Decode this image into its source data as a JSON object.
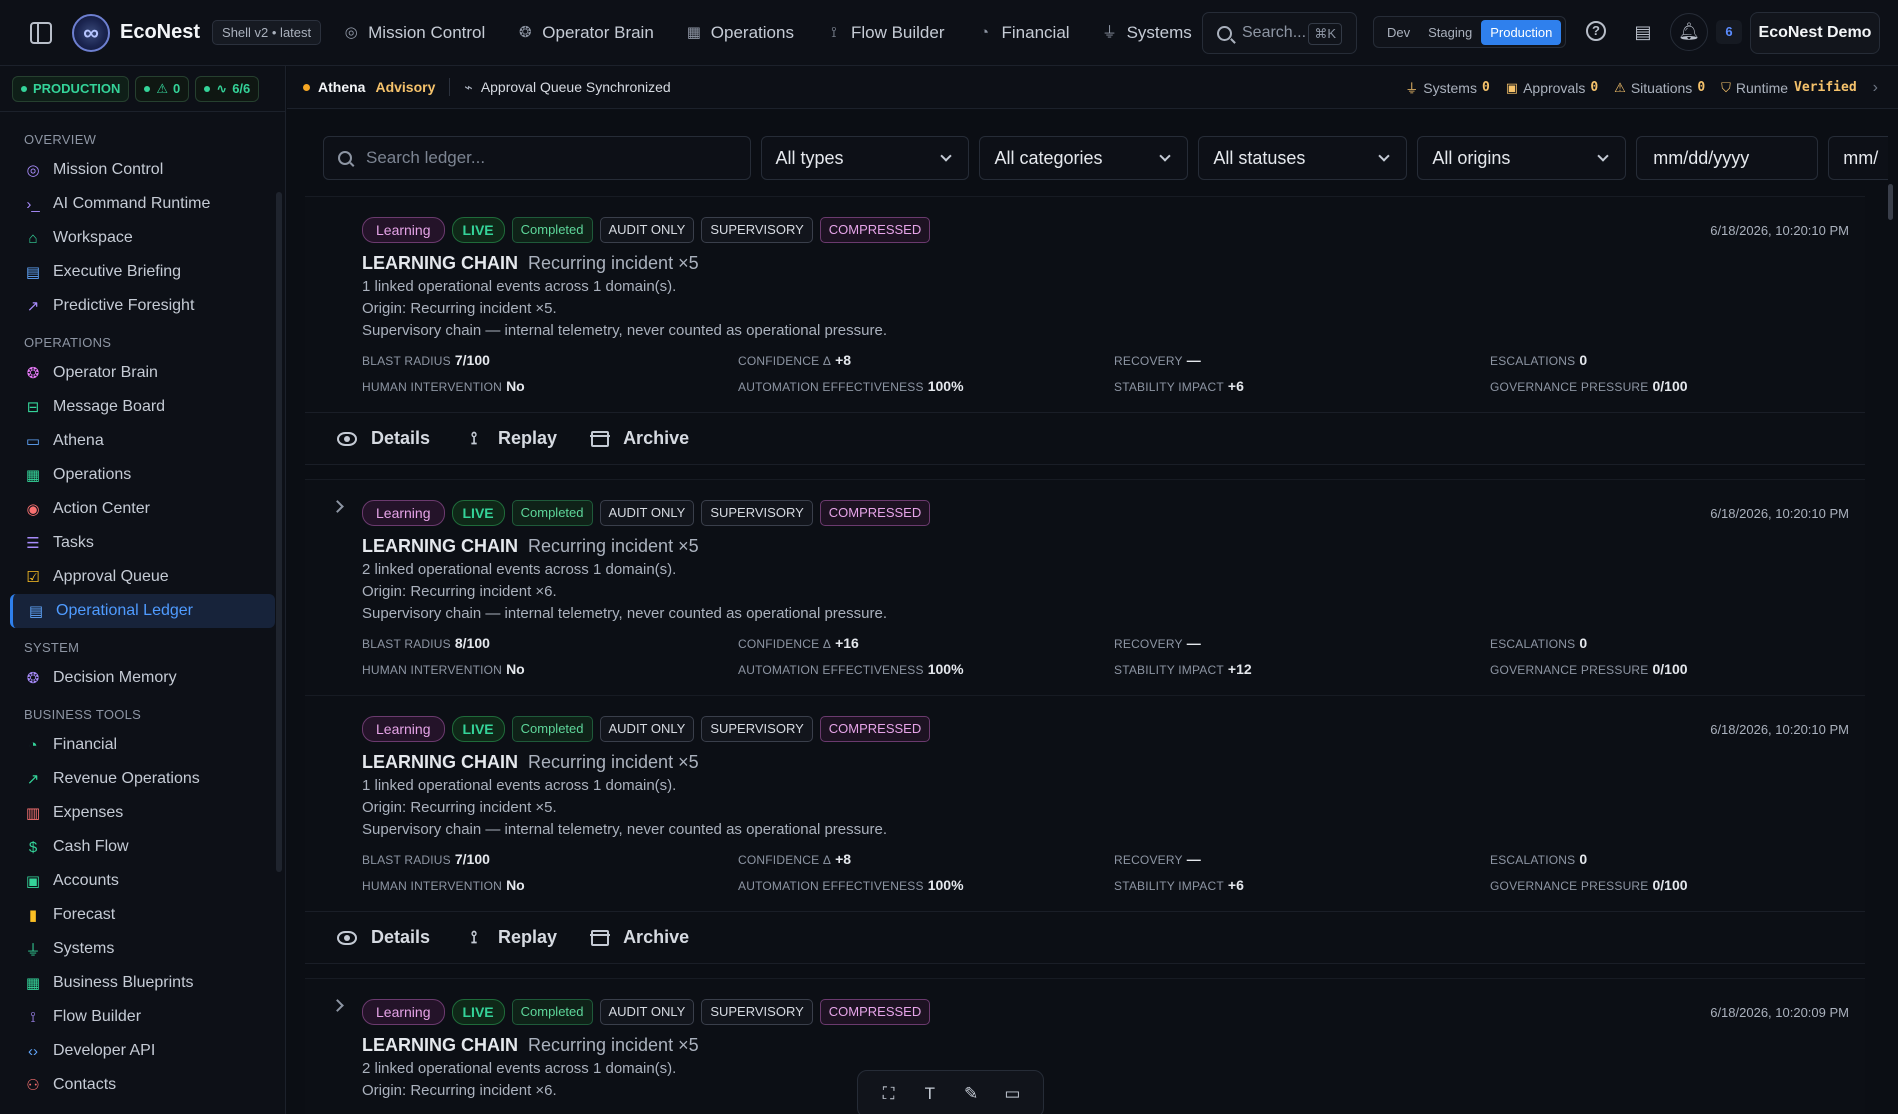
{
  "topbar": {
    "brand": "EcoNest",
    "shell_badge": "Shell v2 • latest",
    "nav": [
      {
        "label": "Mission Control",
        "icon": "gauge-icon"
      },
      {
        "label": "Operator Brain",
        "icon": "brain-icon"
      },
      {
        "label": "Operations",
        "icon": "grid-icon"
      },
      {
        "label": "Flow Builder",
        "icon": "flow-icon"
      },
      {
        "label": "Financial",
        "icon": "speedometer-icon"
      },
      {
        "label": "Systems",
        "icon": "plug-icon"
      }
    ],
    "search_placeholder": "Search...",
    "search_shortcut": "⌘K",
    "environments": [
      "Dev",
      "Staging",
      "Production"
    ],
    "active_environment": "Production",
    "notification_count": "6",
    "account": "EcoNest Demo"
  },
  "sidebar": {
    "status": {
      "environment": "PRODUCTION",
      "alerts": "0",
      "health": "6/6"
    },
    "sections": [
      {
        "title": "OVERVIEW",
        "items": [
          {
            "label": "Mission Control",
            "icon": "gauge-icon",
            "color": "#a78bfa"
          },
          {
            "label": "AI Command Runtime",
            "icon": "terminal-icon",
            "color": "#a78bfa"
          },
          {
            "label": "Workspace",
            "icon": "home-icon",
            "color": "#34d399"
          },
          {
            "label": "Executive Briefing",
            "icon": "document-icon",
            "color": "#60a5fa"
          },
          {
            "label": "Predictive Foresight",
            "icon": "trend-up-icon",
            "color": "#a78bfa"
          }
        ]
      },
      {
        "title": "OPERATIONS",
        "items": [
          {
            "label": "Operator Brain",
            "icon": "brain-icon",
            "color": "#e879f9"
          },
          {
            "label": "Message Board",
            "icon": "inbox-icon",
            "color": "#34d399"
          },
          {
            "label": "Athena",
            "icon": "chat-icon",
            "color": "#60a5fa"
          },
          {
            "label": "Operations",
            "icon": "grid-icon",
            "color": "#34d399"
          },
          {
            "label": "Action Center",
            "icon": "target-icon",
            "color": "#f87171"
          },
          {
            "label": "Tasks",
            "icon": "list-check-icon",
            "color": "#a78bfa"
          },
          {
            "label": "Approval Queue",
            "icon": "check-square-icon",
            "color": "#fbbf24"
          },
          {
            "label": "Operational Ledger",
            "icon": "ledger-icon",
            "color": "#60a5fa",
            "active": true
          }
        ]
      },
      {
        "title": "SYSTEM",
        "items": [
          {
            "label": "Decision Memory",
            "icon": "brain-icon",
            "color": "#a78bfa"
          }
        ]
      },
      {
        "title": "BUSINESS TOOLS",
        "items": [
          {
            "label": "Financial",
            "icon": "speedometer-icon",
            "color": "#34d399"
          },
          {
            "label": "Revenue Operations",
            "icon": "trend-up-icon",
            "color": "#34d399"
          },
          {
            "label": "Expenses",
            "icon": "receipt-icon",
            "color": "#f87171"
          },
          {
            "label": "Cash Flow",
            "icon": "dollar-icon",
            "color": "#34d399"
          },
          {
            "label": "Accounts",
            "icon": "wallet-icon",
            "color": "#34d399"
          },
          {
            "label": "Forecast",
            "icon": "bar-chart-icon",
            "color": "#fbbf24"
          },
          {
            "label": "Systems",
            "icon": "plug-icon",
            "color": "#34d399"
          },
          {
            "label": "Business Blueprints",
            "icon": "grid-icon",
            "color": "#34d399"
          },
          {
            "label": "Flow Builder",
            "icon": "flow-icon",
            "color": "#a78bfa"
          },
          {
            "label": "Developer API",
            "icon": "code-icon",
            "color": "#60a5fa"
          },
          {
            "label": "Contacts",
            "icon": "users-icon",
            "color": "#f87171"
          }
        ]
      }
    ]
  },
  "context": {
    "agent": "Athena",
    "mode": "Advisory",
    "status": "Approval Queue Synchronized",
    "metrics": [
      {
        "label": "Systems",
        "value": "0"
      },
      {
        "label": "Approvals",
        "value": "0"
      },
      {
        "label": "Situations",
        "value": "0"
      },
      {
        "label": "Runtime",
        "value": "Verified"
      }
    ]
  },
  "filters": {
    "search_placeholder": "Search ledger...",
    "type": "All types",
    "category": "All categories",
    "status": "All statuses",
    "origin": "All origins",
    "date_from": "mm/dd/yyyy",
    "date_to": "mm/"
  },
  "entries": [
    {
      "tags": [
        "Learning",
        "LIVE",
        "Completed",
        "AUDIT ONLY",
        "SUPERVISORY",
        "COMPRESSED"
      ],
      "timestamp": "6/18/2026, 10:20:10 PM",
      "kind": "LEARNING CHAIN",
      "subtitle": "Recurring incident ×5",
      "lines": [
        "1 linked operational events across 1 domain(s).",
        "Origin: Recurring incident ×5.",
        "Supervisory chain — internal telemetry, never counted as operational pressure."
      ],
      "metrics": {
        "blast_radius": "7/100",
        "confidence_delta": "+8",
        "recovery": "—",
        "escalations": "0",
        "human_intervention": "No",
        "automation_effectiveness": "100%",
        "stability_impact": "+6",
        "governance_pressure": "0/100"
      },
      "expanded": true
    },
    {
      "tags": [
        "Learning",
        "LIVE",
        "Completed",
        "AUDIT ONLY",
        "SUPERVISORY",
        "COMPRESSED"
      ],
      "timestamp": "6/18/2026, 10:20:10 PM",
      "kind": "LEARNING CHAIN",
      "subtitle": "Recurring incident ×5",
      "lines": [
        "2 linked operational events across 1 domain(s).",
        "Origin: Recurring incident ×6.",
        "Supervisory chain — internal telemetry, never counted as operational pressure."
      ],
      "metrics": {
        "blast_radius": "8/100",
        "confidence_delta": "+16",
        "recovery": "—",
        "escalations": "0",
        "human_intervention": "No",
        "automation_effectiveness": "100%",
        "stability_impact": "+12",
        "governance_pressure": "0/100"
      },
      "expanded": false
    },
    {
      "tags": [
        "Learning",
        "LIVE",
        "Completed",
        "AUDIT ONLY",
        "SUPERVISORY",
        "COMPRESSED"
      ],
      "timestamp": "6/18/2026, 10:20:10 PM",
      "kind": "LEARNING CHAIN",
      "subtitle": "Recurring incident ×5",
      "lines": [
        "1 linked operational events across 1 domain(s).",
        "Origin: Recurring incident ×5.",
        "Supervisory chain — internal telemetry, never counted as operational pressure."
      ],
      "metrics": {
        "blast_radius": "7/100",
        "confidence_delta": "+8",
        "recovery": "—",
        "escalations": "0",
        "human_intervention": "No",
        "automation_effectiveness": "100%",
        "stability_impact": "+6",
        "governance_pressure": "0/100"
      },
      "expanded": true
    },
    {
      "tags": [
        "Learning",
        "LIVE",
        "Completed",
        "AUDIT ONLY",
        "SUPERVISORY",
        "COMPRESSED"
      ],
      "timestamp": "6/18/2026, 10:20:09 PM",
      "kind": "LEARNING CHAIN",
      "subtitle": "Recurring incident ×5",
      "lines": [
        "2 linked operational events across 1 domain(s).",
        "Origin: Recurring incident ×6."
      ],
      "metrics": null,
      "expanded": false
    }
  ],
  "metric_labels": {
    "blast_radius": "BLAST RADIUS",
    "confidence_delta": "CONFIDENCE Δ",
    "recovery": "RECOVERY",
    "escalations": "ESCALATIONS",
    "human_intervention": "HUMAN INTERVENTION",
    "automation_effectiveness": "AUTOMATION EFFECTIVENESS",
    "stability_impact": "STABILITY IMPACT",
    "governance_pressure": "GOVERNANCE PRESSURE"
  },
  "actions": {
    "details": "Details",
    "replay": "Replay",
    "archive": "Archive"
  }
}
